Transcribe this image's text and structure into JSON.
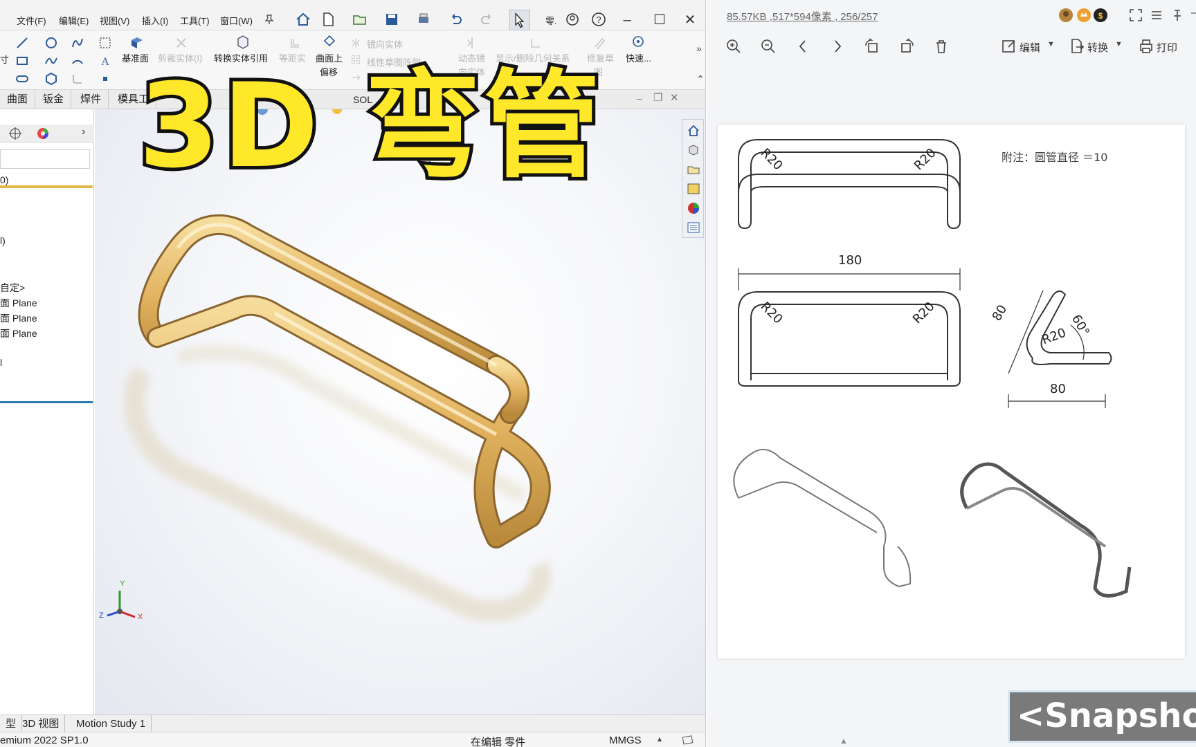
{
  "sw": {
    "menu": [
      "文件(F)",
      "编辑(E)",
      "视图(V)",
      "插入(I)",
      "工具(T)",
      "窗口(W)"
    ],
    "toolbar_extra": "零.",
    "ribbon": {
      "tool_left": "寸",
      "datum_plane": "基准面",
      "trim_body": "剪裁实体(I)",
      "convert_entities": "转换实体引用",
      "offset_entities": "等距实",
      "offset_on_surface_1": "曲面上",
      "offset_on_surface_2": "偏移",
      "mirror_entities": "镜向实体",
      "linear_pattern": "线性草图阵列",
      "move_entities": "移",
      "dynamic_mirror": "动态镜",
      "dynamic_mirror_2": "向实体",
      "show_relations": "显示/删除几何关系",
      "repair_sketch": "修复草",
      "repair_sketch_2": "图",
      "quick_snaps": "快速..."
    },
    "tabs": [
      "曲面",
      "钣金",
      "焊件",
      "模具工",
      "SOL"
    ],
    "tree": {
      "item1": "0)",
      "item2": "l)",
      "item3": "自定>",
      "item4": "面 Plane",
      "item5": "面 Plane",
      "item6": "面 Plane",
      "item7": "l"
    },
    "axis": {
      "x": "X",
      "y": "Y",
      "z": "Z"
    },
    "bottom_tabs": [
      "型",
      "3D 视图",
      "Motion Study 1"
    ],
    "status": {
      "version": "emium 2022 SP1.0",
      "mode": "在编辑 零件",
      "units": "MMGS"
    }
  },
  "overlay_title": "3D 弯管",
  "viewer": {
    "file_info": "85.57KB ,517*594像素 , 256/257",
    "edit": "编辑",
    "convert": "转换",
    "print": "打印",
    "drawing": {
      "note": "附注：圆管直径 ＝10",
      "dim_180": "180",
      "r20": "R20",
      "dim_80_left": "80",
      "dim_80_bottom": "80",
      "dim_60": "60°"
    }
  },
  "snapshot": "<Snapshot"
}
